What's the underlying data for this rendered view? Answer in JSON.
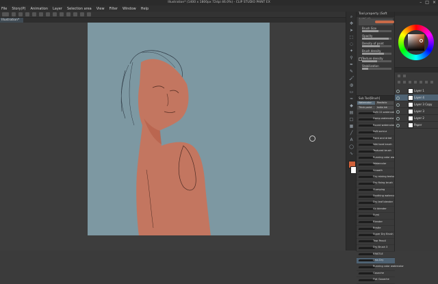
{
  "window": {
    "title": "Illustration* (1400 x 1800px 72dpi 46.0%) - CLIP STUDIO PAINT EX",
    "controls": [
      "–",
      "□",
      "×"
    ]
  },
  "menu": [
    "File",
    "Story(P)",
    "Animation",
    "Layer",
    "Selection area",
    "View",
    "Filter",
    "Window",
    "Help"
  ],
  "document_tab": "Illustration*",
  "tool_property": {
    "header": "Tool property (Soft sumi-e)",
    "brush_size": "Brush Size",
    "opacity": "Opacity",
    "density_of_paint": "Density of paint",
    "brush_density": "Brush density",
    "texture_density": "Texture density",
    "stabilization": "Stabilization",
    "brush_size_value": 0.55,
    "opacity_value": 0.9,
    "paint_density_value": 0.6,
    "brush_density_value": 0.75,
    "texture_density_value": 0.5,
    "stabilization_value": 0.2
  },
  "brush_panel": {
    "header": "Sub Tool[Brush]",
    "tabs": [
      "Watercolor",
      "Realistic",
      "Thick paint",
      "India ink"
    ],
    "items": [
      "Soft CG watercolor",
      "Damp watercolor",
      "Round watercolor",
      "Soft sumi-e",
      "Paint and dried",
      "Wet hard brush",
      "Textured brush",
      "Running color watercolor",
      "Watercolor",
      "Smooth",
      "Dry mixing texture",
      "Dry fixing brush",
      "Stumping",
      "Soothing watercolor",
      "Dry leaf blender",
      "Air blender",
      "Sumi",
      "Blender",
      "Bristle",
      "Super Dry Brush",
      "Tear Pencil",
      "Dry Brush 3",
      "BRISTLE",
      "Less Dry",
      "Running color watercolor",
      "Gouache",
      "Flat Gouache"
    ],
    "selected_index": 23
  },
  "colors": {
    "main": "#d0613a",
    "sub": "#ffffff",
    "accent": "#4e6273"
  },
  "layers": [
    {
      "name": "Layer 1",
      "selected": false
    },
    {
      "name": "Layer 4",
      "selected": true
    },
    {
      "name": "Layer 3 Copy",
      "selected": false
    },
    {
      "name": "Layer 3",
      "selected": false
    },
    {
      "name": "Layer 2",
      "selected": false
    },
    {
      "name": "Paper",
      "selected": false
    }
  ]
}
